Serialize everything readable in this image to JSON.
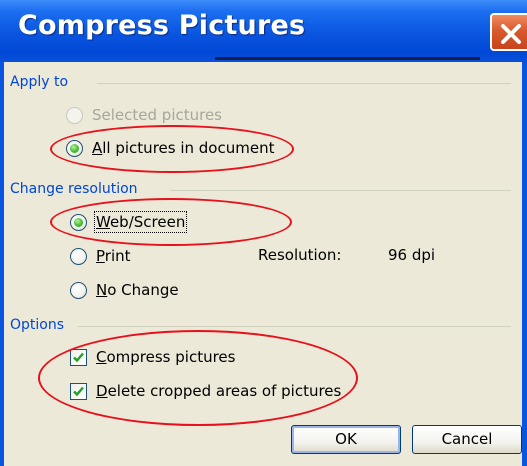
{
  "window": {
    "title": "Compress Pictures"
  },
  "apply_to": {
    "label": "Apply to",
    "options": [
      {
        "label": "Selected pictures",
        "selected": false,
        "enabled": false
      },
      {
        "label_accel": "A",
        "label_rest": "ll pictures in document",
        "selected": true,
        "enabled": true
      }
    ]
  },
  "change_resolution": {
    "label": "Change resolution",
    "options": [
      {
        "label_accel": "W",
        "label_rest": "eb/Screen",
        "selected": true
      },
      {
        "label_accel": "P",
        "label_rest": "rint",
        "selected": false
      },
      {
        "label_accel": "N",
        "label_rest": "o Change",
        "selected": false
      }
    ],
    "resolution_label": "Resolution:",
    "resolution_value": "96 dpi"
  },
  "options": {
    "label": "Options",
    "checkboxes": [
      {
        "label_accel": "C",
        "label_rest": "ompress pictures",
        "checked": true
      },
      {
        "label_accel": "D",
        "label_rest": "elete cropped areas of pictures",
        "checked": true
      }
    ]
  },
  "buttons": {
    "ok": "OK",
    "cancel": "Cancel"
  },
  "colors": {
    "title_bar": "#0a55e0",
    "group_label": "#0046d5",
    "annotation": "#e8101a",
    "dialog_bg": "#ece9d8"
  }
}
